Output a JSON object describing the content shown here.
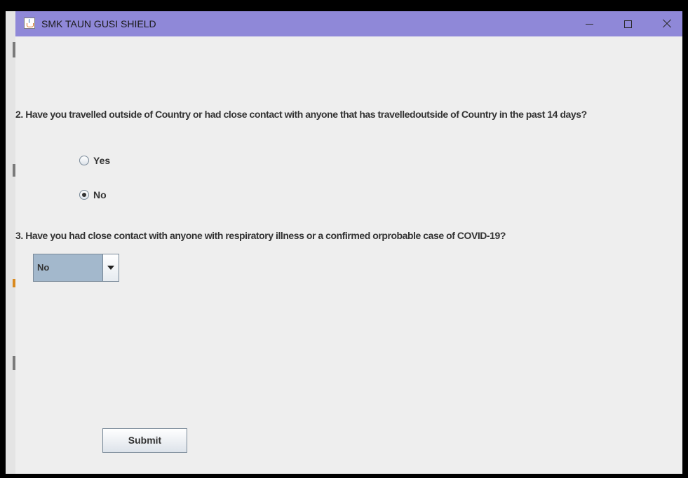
{
  "window": {
    "title": "SMK TAUN GUSI SHIELD",
    "icon": "java-cup-icon",
    "controls": [
      "minimize-icon",
      "maximize-icon",
      "close-icon"
    ],
    "titlebar_color": "#8f88d8",
    "background_color": "#eeeeee"
  },
  "form": {
    "question2": {
      "text": "2. Have you travelled outside of Country or had close contact with anyone that has travelledoutside of Country in the past 14 days?",
      "options": [
        {
          "label": "Yes",
          "selected": false
        },
        {
          "label": "No",
          "selected": true
        }
      ]
    },
    "question3": {
      "text": "3. Have you had close contact with anyone with respiratory illness or a confirmed orprobable case of COVID-19?",
      "selected": "No"
    },
    "submit_label": "Submit"
  }
}
